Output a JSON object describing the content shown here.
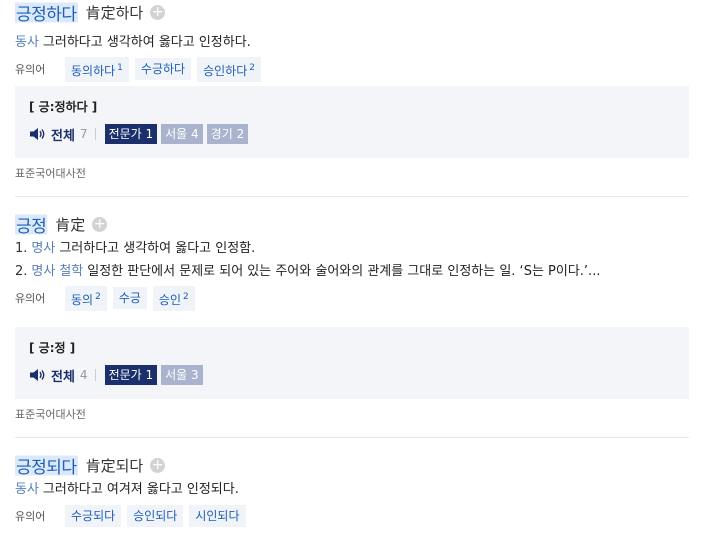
{
  "entries": [
    {
      "word": "긍정하다",
      "hanja_prefix": "肯定",
      "hanja_suffix": "하다",
      "defs": [
        {
          "pos": "동사",
          "text": "그러하다고 생각하여 옳다고 인정하다."
        }
      ],
      "syn_label": "유의어",
      "synonyms": [
        {
          "word": "동의하다",
          "sup": "1"
        },
        {
          "word": "수긍하다",
          "sup": ""
        },
        {
          "word": "승인하다",
          "sup": "2"
        }
      ],
      "pron": {
        "word": "[ 긍:정하다 ]",
        "all_label": "전체",
        "all_count": "7",
        "chips": [
          {
            "label": "전문가 1",
            "active": true
          },
          {
            "label": "서울 4",
            "active": false
          },
          {
            "label": "경기 2",
            "active": false
          }
        ]
      },
      "source": "표준국어대사전"
    },
    {
      "word": "긍정",
      "hanja_prefix": "肯定",
      "hanja_suffix": "",
      "defs": [
        {
          "num": "1.",
          "pos": "명사",
          "field": "",
          "text": "그러하다고 생각하여 옳다고 인정함."
        },
        {
          "num": "2.",
          "pos": "명사",
          "field": "철학",
          "text": "일정한 판단에서 문제로 되어 있는 주어와 술어와의 관계를 그대로 인정하는 일. ‘S는 P이다.’..."
        }
      ],
      "syn_label": "유의어",
      "synonyms": [
        {
          "word": "동의",
          "sup": "2"
        },
        {
          "word": "수긍",
          "sup": ""
        },
        {
          "word": "승인",
          "sup": "2"
        }
      ],
      "pron": {
        "word": "[ 긍:정 ]",
        "all_label": "전체",
        "all_count": "4",
        "chips": [
          {
            "label": "전문가 1",
            "active": true
          },
          {
            "label": "서울 3",
            "active": false
          }
        ]
      },
      "source": "표준국어대사전"
    },
    {
      "word": "긍정되다",
      "hanja_prefix": "肯定",
      "hanja_suffix": "되다",
      "defs": [
        {
          "pos": "동사",
          "text": "그러하다고 여겨져 옳다고 인정되다."
        }
      ],
      "syn_label": "유의어",
      "synonyms": [
        {
          "word": "수긍되다",
          "sup": ""
        },
        {
          "word": "승인되다",
          "sup": ""
        },
        {
          "word": "시인되다",
          "sup": ""
        }
      ]
    }
  ],
  "icons": {
    "plus": "plus-circle-icon",
    "speaker": "speaker-icon"
  },
  "colors": {
    "link": "#1d5fb8",
    "highlight": "#dce9fa",
    "chip_active": "#1a2f6b",
    "chip_inactive": "#a9b3cd",
    "pron_bg": "#f3f5f8"
  }
}
